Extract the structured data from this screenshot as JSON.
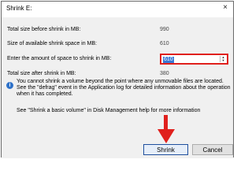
{
  "window": {
    "title": "Shrink E:",
    "close_glyph": "×"
  },
  "fields": [
    {
      "label": "Total size before shrink in MB:",
      "value": "990"
    },
    {
      "label": "Size of available shrink space in MB:",
      "value": "610"
    },
    {
      "label": "Enter the amount of space to shrink in MB:",
      "value": "610"
    },
    {
      "label": "Total size after shrink in MB:",
      "value": "380"
    }
  ],
  "info": {
    "icon": "info-icon",
    "text": "You cannot shrink a volume beyond the point where any unmovable files are located. See the \"defrag\" event in the Application log for detailed information about the operation when it has completed."
  },
  "help_text": "See \"Shrink a basic volume\" in Disk Management help for more information",
  "buttons": {
    "shrink": "Shrink",
    "cancel": "Cancel"
  },
  "colors": {
    "highlight_border": "#e0201d",
    "selection": "#3a78d4",
    "arrow": "#e0201d",
    "dialog_background": "#f0f0f0"
  }
}
